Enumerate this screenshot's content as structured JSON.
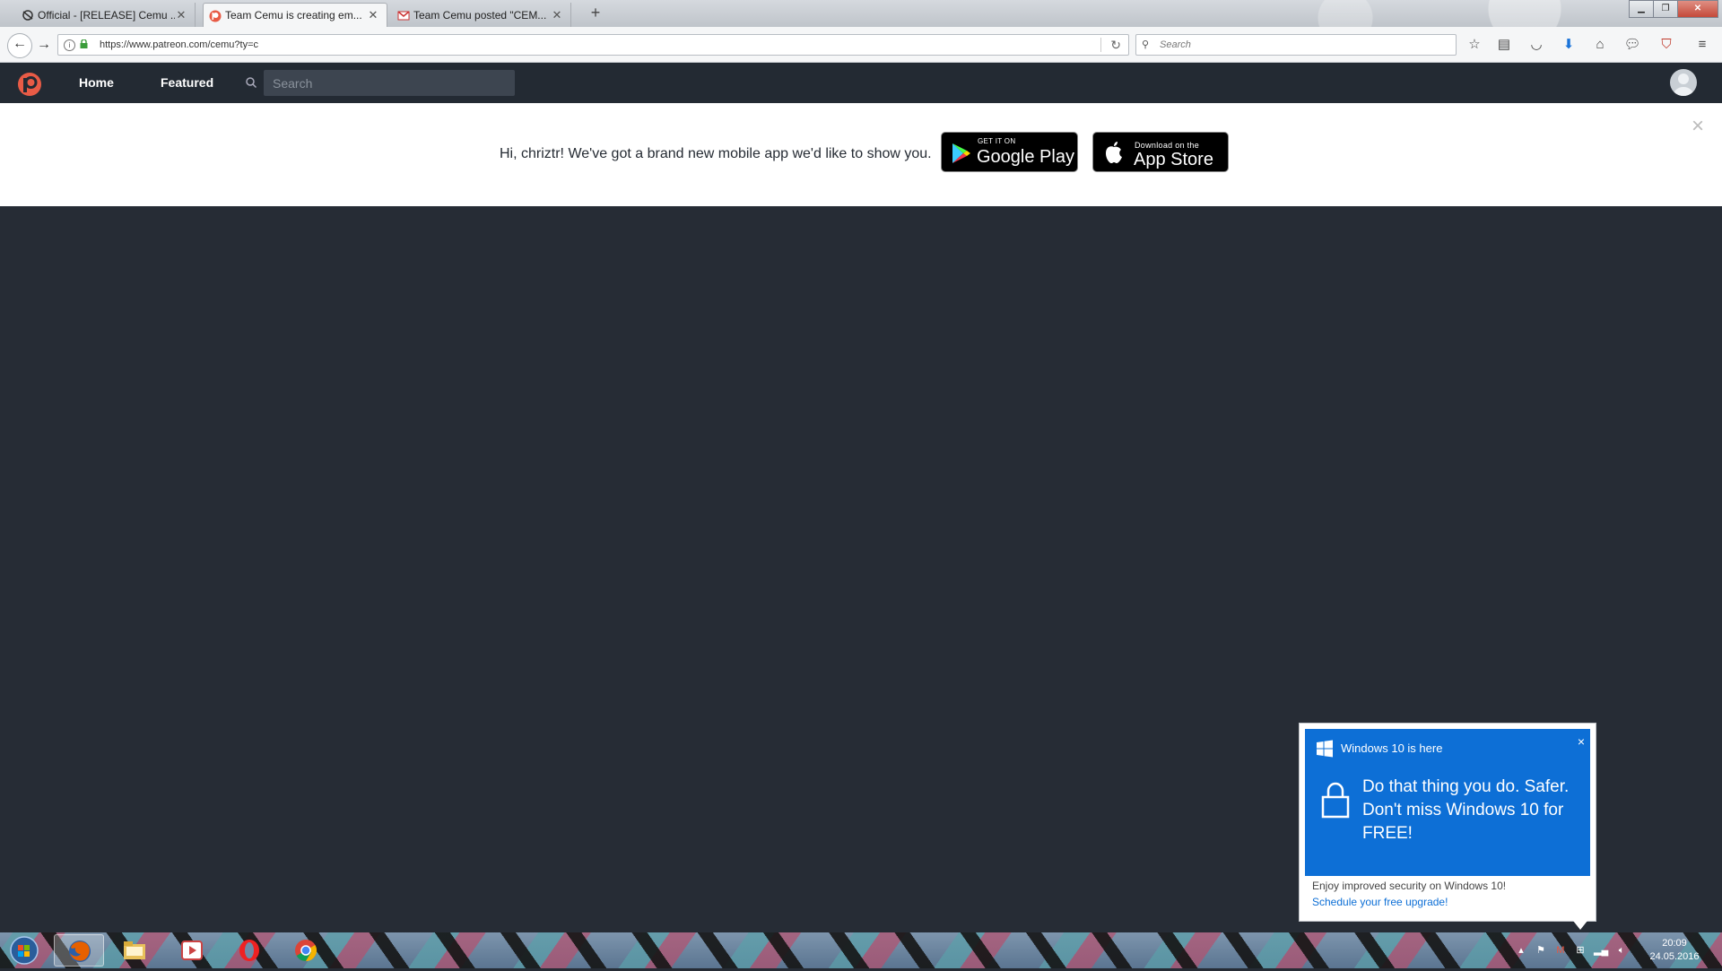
{
  "browser": {
    "tabs": [
      {
        "title": "Official - [RELEASE] Cemu ...",
        "favicon": "cemu-icon",
        "active": false
      },
      {
        "title": "Team Cemu is creating em...",
        "favicon": "patreon-icon",
        "active": true
      },
      {
        "title": "Team Cemu posted \"CEM...",
        "favicon": "gmail-icon",
        "active": false
      }
    ],
    "new_tab_label": "+",
    "url": "https://www.patreon.com/cemu?ty=c",
    "search_placeholder": "Search"
  },
  "patreon": {
    "nav": {
      "home": "Home",
      "featured": "Featured"
    },
    "search_placeholder": "Search",
    "banner": {
      "message": "Hi, chriztr! We've got a brand new mobile app we'd like to show you.",
      "google_small": "GET IT ON",
      "google_big": "Google Play",
      "apple_small": "Download on the",
      "apple_big": "App Store",
      "close": "×"
    }
  },
  "win10_popup": {
    "title": "Windows 10 is here",
    "message": "Do that thing you do. Safer. Don't miss Windows 10 for FREE!",
    "subtext": "Enjoy improved security on Windows 10!",
    "link": "Schedule your free upgrade!",
    "close": "×"
  },
  "taskbar": {
    "apps": [
      "firefox-icon",
      "explorer-icon",
      "media-player-icon",
      "opera-icon",
      "chrome-icon"
    ],
    "time": "20:09",
    "date": "24.05.2016"
  },
  "colors": {
    "patreon_orange": "#e85b46",
    "page_bg": "#262c35",
    "win10_blue": "#0d6fd6"
  }
}
